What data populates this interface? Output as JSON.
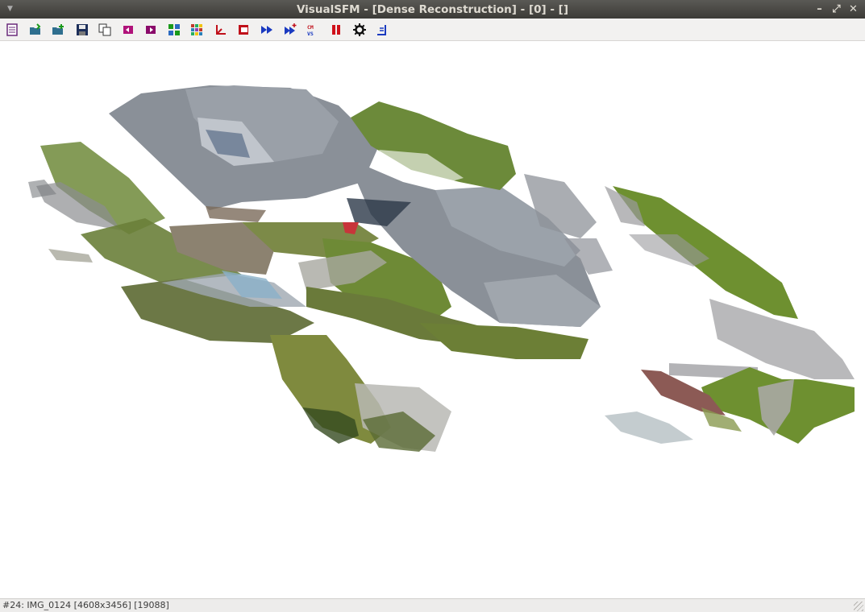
{
  "window": {
    "title": "VisualSFM - [Dense Reconstruction] - [0] - []",
    "controls": [
      "minimize",
      "maximize",
      "close"
    ]
  },
  "toolbar": {
    "buttons": [
      {
        "name": "log-window-icon"
      },
      {
        "name": "open-images-icon"
      },
      {
        "name": "add-images-icon"
      },
      {
        "name": "save-nvm-icon"
      },
      {
        "name": "copy-icon"
      },
      {
        "name": "show-thumbnails-icon"
      },
      {
        "name": "show-features-icon"
      },
      {
        "name": "compute-matches-icon"
      },
      {
        "name": "match-matrix-icon"
      },
      {
        "name": "sparse-3d-icon"
      },
      {
        "name": "camera-view-icon"
      },
      {
        "name": "compute-3d-icon"
      },
      {
        "name": "resume-3d-icon"
      },
      {
        "name": "cmvs-icon"
      },
      {
        "name": "pause-icon"
      },
      {
        "name": "settings-gear-icon"
      },
      {
        "name": "coordinate-icon"
      }
    ]
  },
  "status": {
    "text": "#24: IMG_0124 [4608x3456] [19088]"
  },
  "colors": {
    "titlebar": "#3c3b37",
    "roof": "#8a9098",
    "grass": "#6f8a3a",
    "ground": "#8c8270"
  }
}
